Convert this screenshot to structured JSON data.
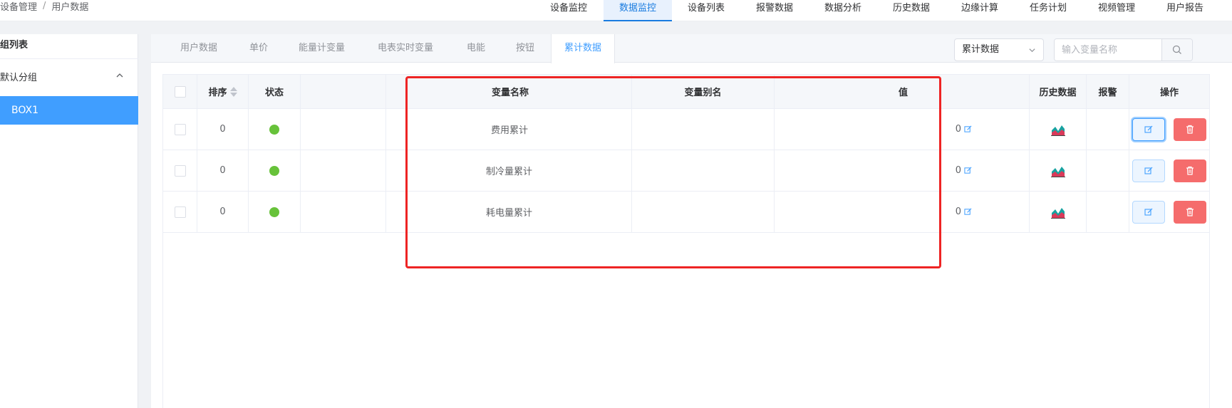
{
  "breadcrumb": {
    "root": "设备管理",
    "sep": "/",
    "current": "用户数据"
  },
  "topnav": [
    {
      "label": "设备监控",
      "active": false
    },
    {
      "label": "数据监控",
      "active": true
    },
    {
      "label": "设备列表",
      "active": false
    },
    {
      "label": "报警数据",
      "active": false
    },
    {
      "label": "数据分析",
      "active": false
    },
    {
      "label": "历史数据",
      "active": false
    },
    {
      "label": "边缘计算",
      "active": false
    },
    {
      "label": "任务计划",
      "active": false
    },
    {
      "label": "视频管理",
      "active": false
    },
    {
      "label": "用户报告",
      "active": false
    }
  ],
  "sidebar": {
    "title": "组列表",
    "group": "默认分组",
    "box": "BOX1"
  },
  "tabs": [
    {
      "label": "用户数据"
    },
    {
      "label": "单价"
    },
    {
      "label": "能量计变量"
    },
    {
      "label": "电表实时变量"
    },
    {
      "label": "电能"
    },
    {
      "label": "按钮"
    },
    {
      "label": "累计数据"
    }
  ],
  "filter": {
    "select_value": "累计数据",
    "search_placeholder": "输入变量名称"
  },
  "table": {
    "headers": {
      "sort": "排序",
      "status": "状态",
      "name": "变量名称",
      "alias": "变量别名",
      "value": "值",
      "history": "历史数据",
      "alarm": "报警",
      "ops": "操作"
    },
    "rows": [
      {
        "sort": "0",
        "name": "费用累计",
        "alias": "",
        "value": "0",
        "status": "online"
      },
      {
        "sort": "0",
        "name": "制冷量累计",
        "alias": "",
        "value": "0",
        "status": "online"
      },
      {
        "sort": "0",
        "name": "耗电量累计",
        "alias": "",
        "value": "0",
        "status": "online"
      }
    ]
  },
  "colors": {
    "accent": "#409eff",
    "status_online": "#67c23a",
    "danger": "#f56c6c",
    "highlight": "#ee2424"
  }
}
